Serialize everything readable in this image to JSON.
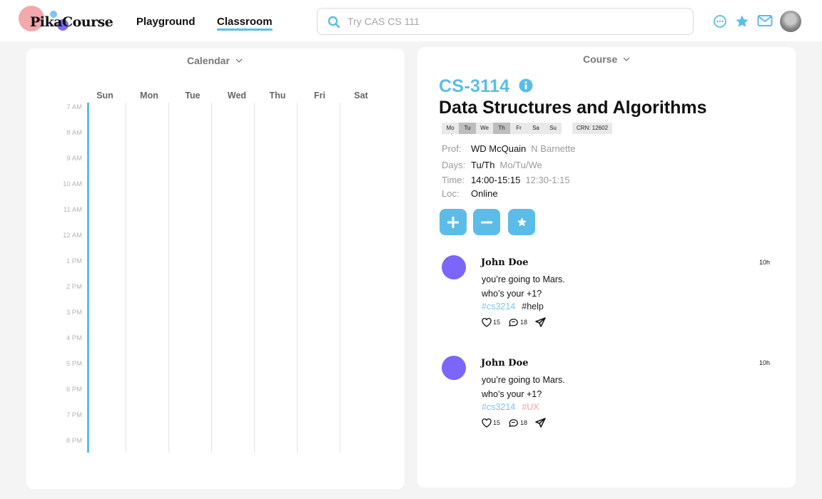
{
  "brand": {
    "logo_text": "PikaCourse"
  },
  "nav": {
    "playground": "Playground",
    "classroom": "Classroom"
  },
  "search": {
    "placeholder": "Try CAS CS 111"
  },
  "header_icons": [
    "chat-icon",
    "star-icon",
    "mail-icon",
    "user-avatar"
  ],
  "colors": {
    "accent": "#5bbde7",
    "avatar_purple": "#7c65fb",
    "tag_pink": "#f2a3a8"
  },
  "calendar": {
    "title": "Calendar",
    "days": [
      "Sun",
      "Mon",
      "Tue",
      "Wed",
      "Thu",
      "Fri",
      "Sat"
    ],
    "hours": [
      "7 AM",
      "8 AM",
      "9 AM",
      "10 AM",
      "11 AM",
      "12 AM",
      "1 PM",
      "2 PM",
      "3 PM",
      "4 PM",
      "5 PM",
      "6 PM",
      "7 PM",
      "8 PM"
    ]
  },
  "course": {
    "panel_title": "Course",
    "code": "CS-3114",
    "name": "Data Structures and Algorithms",
    "day_chips": [
      {
        "label": "Mo",
        "active": false
      },
      {
        "label": "Tu",
        "active": true
      },
      {
        "label": "We",
        "active": false
      },
      {
        "label": "Th",
        "active": true
      },
      {
        "label": "Fr",
        "active": false
      },
      {
        "label": "Sa",
        "active": false
      },
      {
        "label": "Su",
        "active": false
      }
    ],
    "crn": "CRN: 12602",
    "prof_label": "Prof:",
    "prof": "WD McQuain",
    "prof_alt": "N Barnette",
    "days_label": "Days:",
    "days": "Tu/Th",
    "days_alt": "Mo/Tu/We",
    "time_label": "Time:",
    "time": "14:00-15:15",
    "time_alt": "12:30-1:15",
    "loc_label": "Loc:",
    "loc": "Online"
  },
  "posts": [
    {
      "author": "John Doe",
      "time": "10h",
      "line1": "you’re going to Mars.",
      "line2": "who’s your +1?",
      "tag1": "#cs3214",
      "tag2": "#help",
      "likes": "15",
      "comments": "18"
    },
    {
      "author": "John Doe",
      "time": "10h",
      "line1": "you’re going to Mars.",
      "line2": "who’s your +1?",
      "tag1": "#cs3214",
      "tag2": "#UX",
      "likes": "15",
      "comments": "18"
    }
  ]
}
